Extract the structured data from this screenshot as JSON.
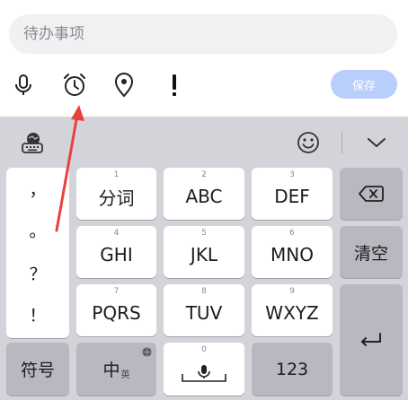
{
  "todo": {
    "placeholder": "待办事项",
    "save_label": "保存",
    "tools": [
      {
        "name": "microphone-icon"
      },
      {
        "name": "alarm-clock-icon"
      },
      {
        "name": "location-pin-icon"
      },
      {
        "name": "exclamation-icon"
      }
    ]
  },
  "keyboard": {
    "toolbar": {
      "left_icon": "keyboard-globe-icon",
      "emoji_icon": "emoji-icon",
      "collapse_icon": "chevron-down-icon"
    },
    "punctuation": [
      "，",
      "。",
      "？",
      "！"
    ],
    "keys": [
      {
        "num": "1",
        "label": "分词"
      },
      {
        "num": "2",
        "label": "ABC"
      },
      {
        "num": "3",
        "label": "DEF"
      },
      {
        "num": "4",
        "label": "GHI"
      },
      {
        "num": "5",
        "label": "JKL"
      },
      {
        "num": "6",
        "label": "MNO"
      },
      {
        "num": "7",
        "label": "PQRS"
      },
      {
        "num": "8",
        "label": "TUV"
      },
      {
        "num": "9",
        "label": "WXYZ"
      }
    ],
    "clear_label": "清空",
    "symbols_label": "符号",
    "chinese_label": "中",
    "chinese_sub": "英",
    "space_num": "0",
    "numbers_label": "123"
  },
  "colors": {
    "accent_disabled": "#b9cffb",
    "keyboard_bg": "#d3d4da",
    "arrow": "#e8413b"
  }
}
